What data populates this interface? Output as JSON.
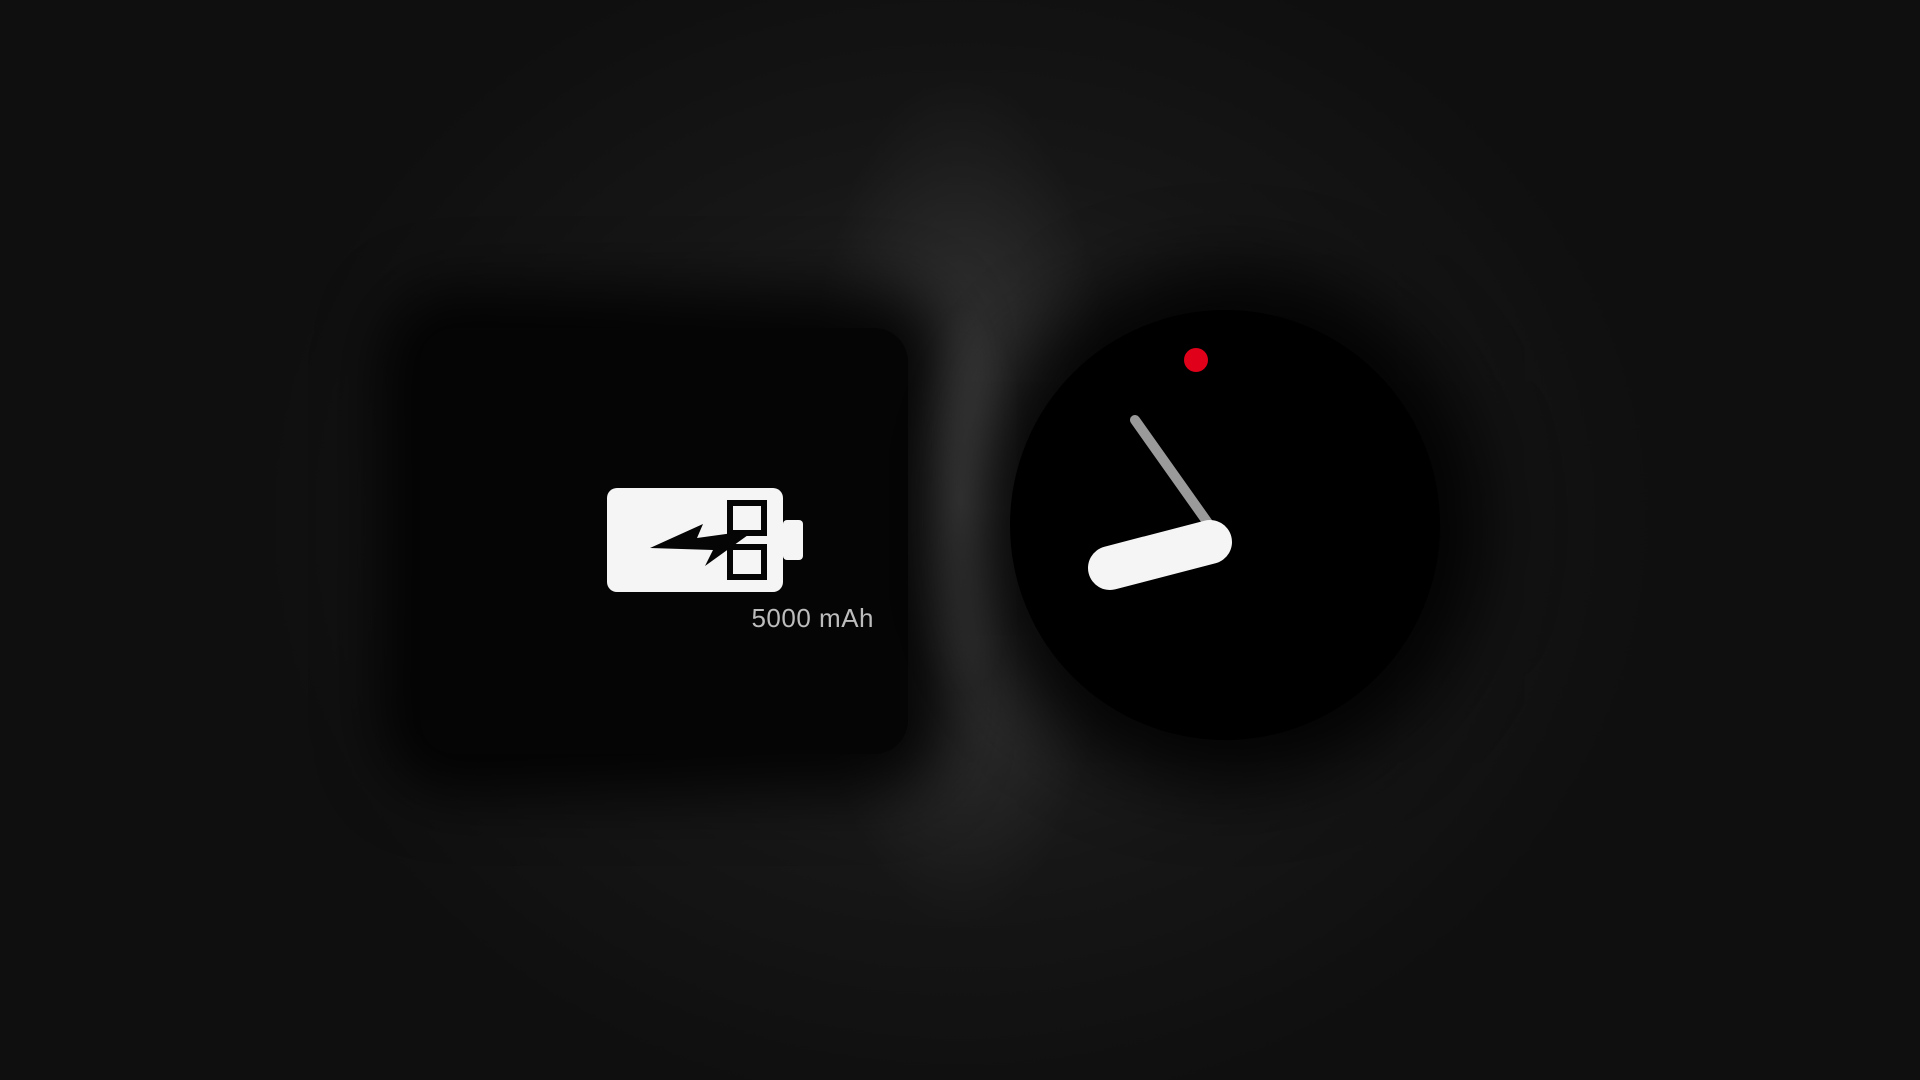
{
  "battery_card": {
    "icon": "charging-battery-icon",
    "capacity_label": "5000 mAh"
  },
  "clock": {
    "hour_hand_color": "#f5f5f5",
    "minute_hand_color": "#9a9a9a",
    "indicator_dot_color": "#e0001a"
  },
  "colors": {
    "background": "#111111",
    "card": "#050505",
    "icon": "#f5f5f5",
    "label": "#bdbdbd"
  }
}
